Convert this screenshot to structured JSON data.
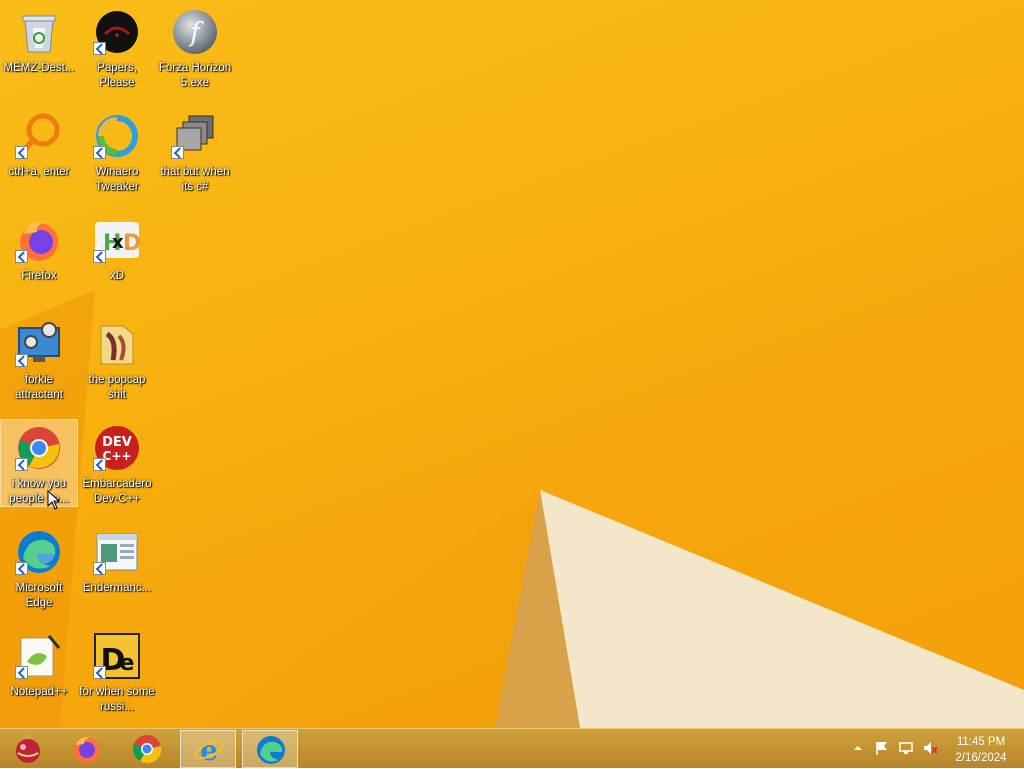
{
  "desktop_icons": [
    {
      "label": "MEMZ-Dest...",
      "icon": "recycle-bin-icon"
    },
    {
      "label": "Papers, Please",
      "icon": "papers-please-icon"
    },
    {
      "label": "Forza Horizon 5.exe",
      "icon": "flash-icon"
    },
    {
      "label": "ctrl+a, enter",
      "icon": "orange-search-icon"
    },
    {
      "label": "Winaero Tweaker",
      "icon": "winaero-icon"
    },
    {
      "label": "that but when its c#",
      "icon": "stacked-windows-icon"
    },
    {
      "label": "Firefox",
      "icon": "firefox-icon"
    },
    {
      "label": "xD",
      "icon": "hxd-icon"
    },
    {
      "label": "forkie attractant",
      "icon": "monitor-gear-icon"
    },
    {
      "label": "the popcap shit",
      "icon": "folder-icon"
    },
    {
      "label": "i know you people se...",
      "icon": "chrome-icon"
    },
    {
      "label": "Embarcadero Dev-C++",
      "icon": "devcpp-icon"
    },
    {
      "label": "Microsoft Edge",
      "icon": "edge-icon"
    },
    {
      "label": "Endermanc...",
      "icon": "window-app-icon"
    },
    {
      "label": "Notepad++",
      "icon": "notepadpp-icon"
    },
    {
      "label": "for when some russi...",
      "icon": "de-icon"
    }
  ],
  "taskbar": {
    "buttons": [
      {
        "name": "start-orb",
        "icon": "ornament-icon"
      },
      {
        "name": "firefox",
        "icon": "firefox-icon"
      },
      {
        "name": "chrome",
        "icon": "chrome-icon"
      },
      {
        "name": "internet-explorer",
        "icon": "ie-icon"
      },
      {
        "name": "edge",
        "icon": "edge-icon"
      }
    ]
  },
  "tray": {
    "time": "11:45 PM",
    "date": "2/16/2024"
  },
  "colors": {
    "wallpaper": "#f8b310",
    "taskbar": "#c4952f"
  }
}
